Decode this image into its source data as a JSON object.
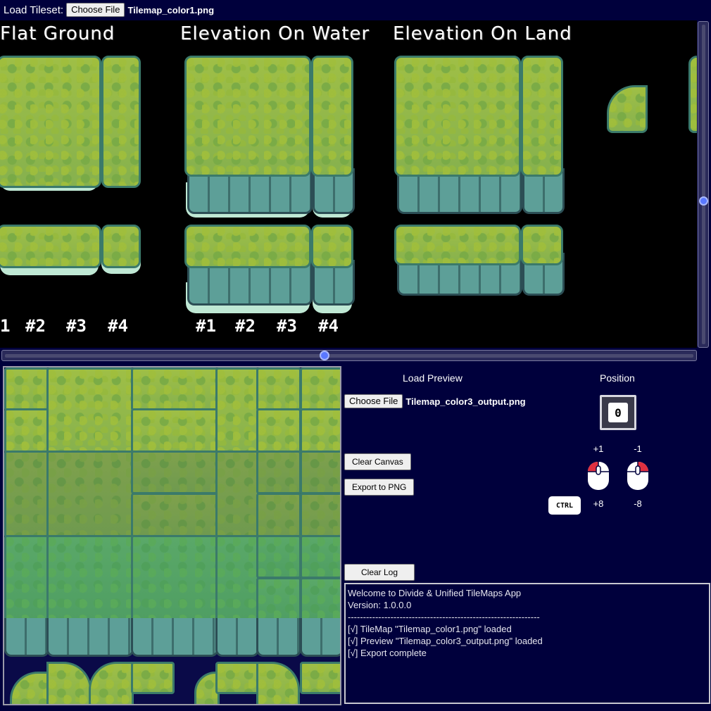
{
  "topbar": {
    "load_tileset_label": "Load Tileset:",
    "choose_file_label": "Choose File",
    "tileset_file_name": "Tilemap_color1.png"
  },
  "tileset": {
    "titles": [
      "Flat Ground",
      "Elevation On Water",
      "Elevation On Land"
    ],
    "numbers_flat": [
      "1",
      "#2",
      "#3",
      "#4"
    ],
    "numbers_water": [
      "#1",
      "#2",
      "#3",
      "#4"
    ]
  },
  "preview": {
    "title": "Load Preview",
    "choose_file_label": "Choose File",
    "file_name": "Tilemap_color3_output.png"
  },
  "actions": {
    "clear_canvas": "Clear Canvas",
    "export_png": "Export to PNG",
    "clear_log": "Clear Log"
  },
  "position": {
    "title": "Position",
    "value": "0",
    "left_click": "+1",
    "right_click": "-1",
    "ctrl_left": "+8",
    "ctrl_right": "-8",
    "ctrl_label": "CTRL"
  },
  "log": {
    "lines": [
      "Welcome to Divide & Unified TileMaps App",
      "Version: 1.0.0.0",
      "---------------------------------------------------------------",
      "",
      "[√] TileMap \"Tilemap_color1.png\" loaded",
      "[√] Preview \"Tilemap_color3_output.png\" loaded",
      "[√] Export complete"
    ]
  },
  "colors": {
    "background": "#00003c",
    "tileset_bg": "#000000",
    "grass": "#9fbf46",
    "cliff": "#5d9f98",
    "slider_thumb": "#5a78ff",
    "mouse_button": "#e03040"
  }
}
